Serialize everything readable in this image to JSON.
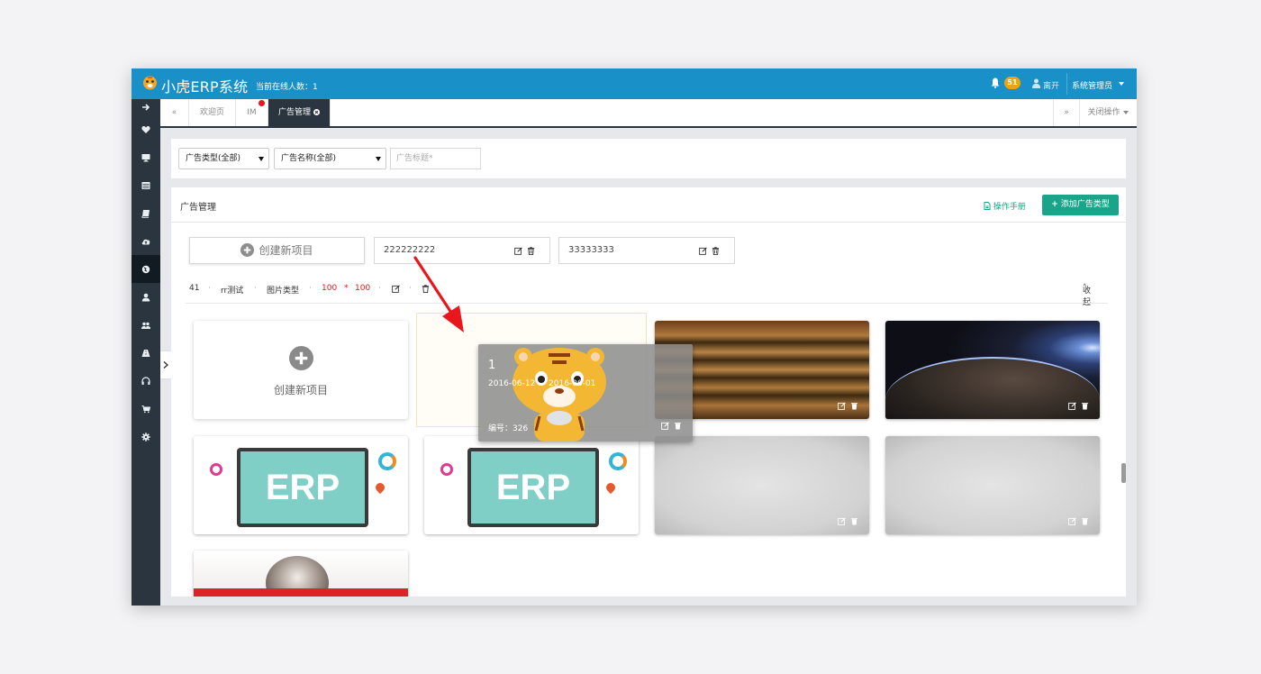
{
  "app": {
    "title": "小虎ERP系统",
    "online_text": "当前在线人数：1",
    "notification_count": "51",
    "leave_label": "离开",
    "user_label": "系统管理员",
    "accent_color": "#1a90c8"
  },
  "sidebar": {
    "items": [
      {
        "icon": "arrow-right-icon"
      },
      {
        "icon": "heart-icon"
      },
      {
        "icon": "desktop-icon"
      },
      {
        "icon": "list-icon"
      },
      {
        "icon": "book-icon"
      },
      {
        "icon": "cloud-upload-icon"
      },
      {
        "icon": "globe-icon",
        "active": true
      },
      {
        "icon": "user-icon"
      },
      {
        "icon": "users-icon"
      },
      {
        "icon": "road-icon"
      },
      {
        "icon": "headphones-icon"
      },
      {
        "icon": "cart-icon"
      },
      {
        "icon": "gear-icon"
      }
    ]
  },
  "tabs": {
    "prev": "«",
    "next": "»",
    "items": [
      "欢迎页",
      "IM",
      "广告管理"
    ],
    "close_ops": "关闭操作"
  },
  "filters": {
    "ad_type": "广告类型(全部)",
    "ad_name": "广告名称(全部)",
    "title_placeholder": "广告标题*"
  },
  "panel": {
    "title": "广告管理",
    "manual_label": "操作手册",
    "add_label": "添加广告类型",
    "create_new": "创建新项目",
    "types": [
      "222222222",
      "33333333"
    ],
    "info": {
      "id": "41",
      "name": "rr测试",
      "kind": "图片类型",
      "width": "100",
      "times": "*",
      "height": "100",
      "collapse": "收起"
    },
    "drag_card": {
      "number": "1",
      "dates": "2016-06-12 — 2016-06-01",
      "code": "编号：326"
    },
    "erp_text": "ERP"
  }
}
